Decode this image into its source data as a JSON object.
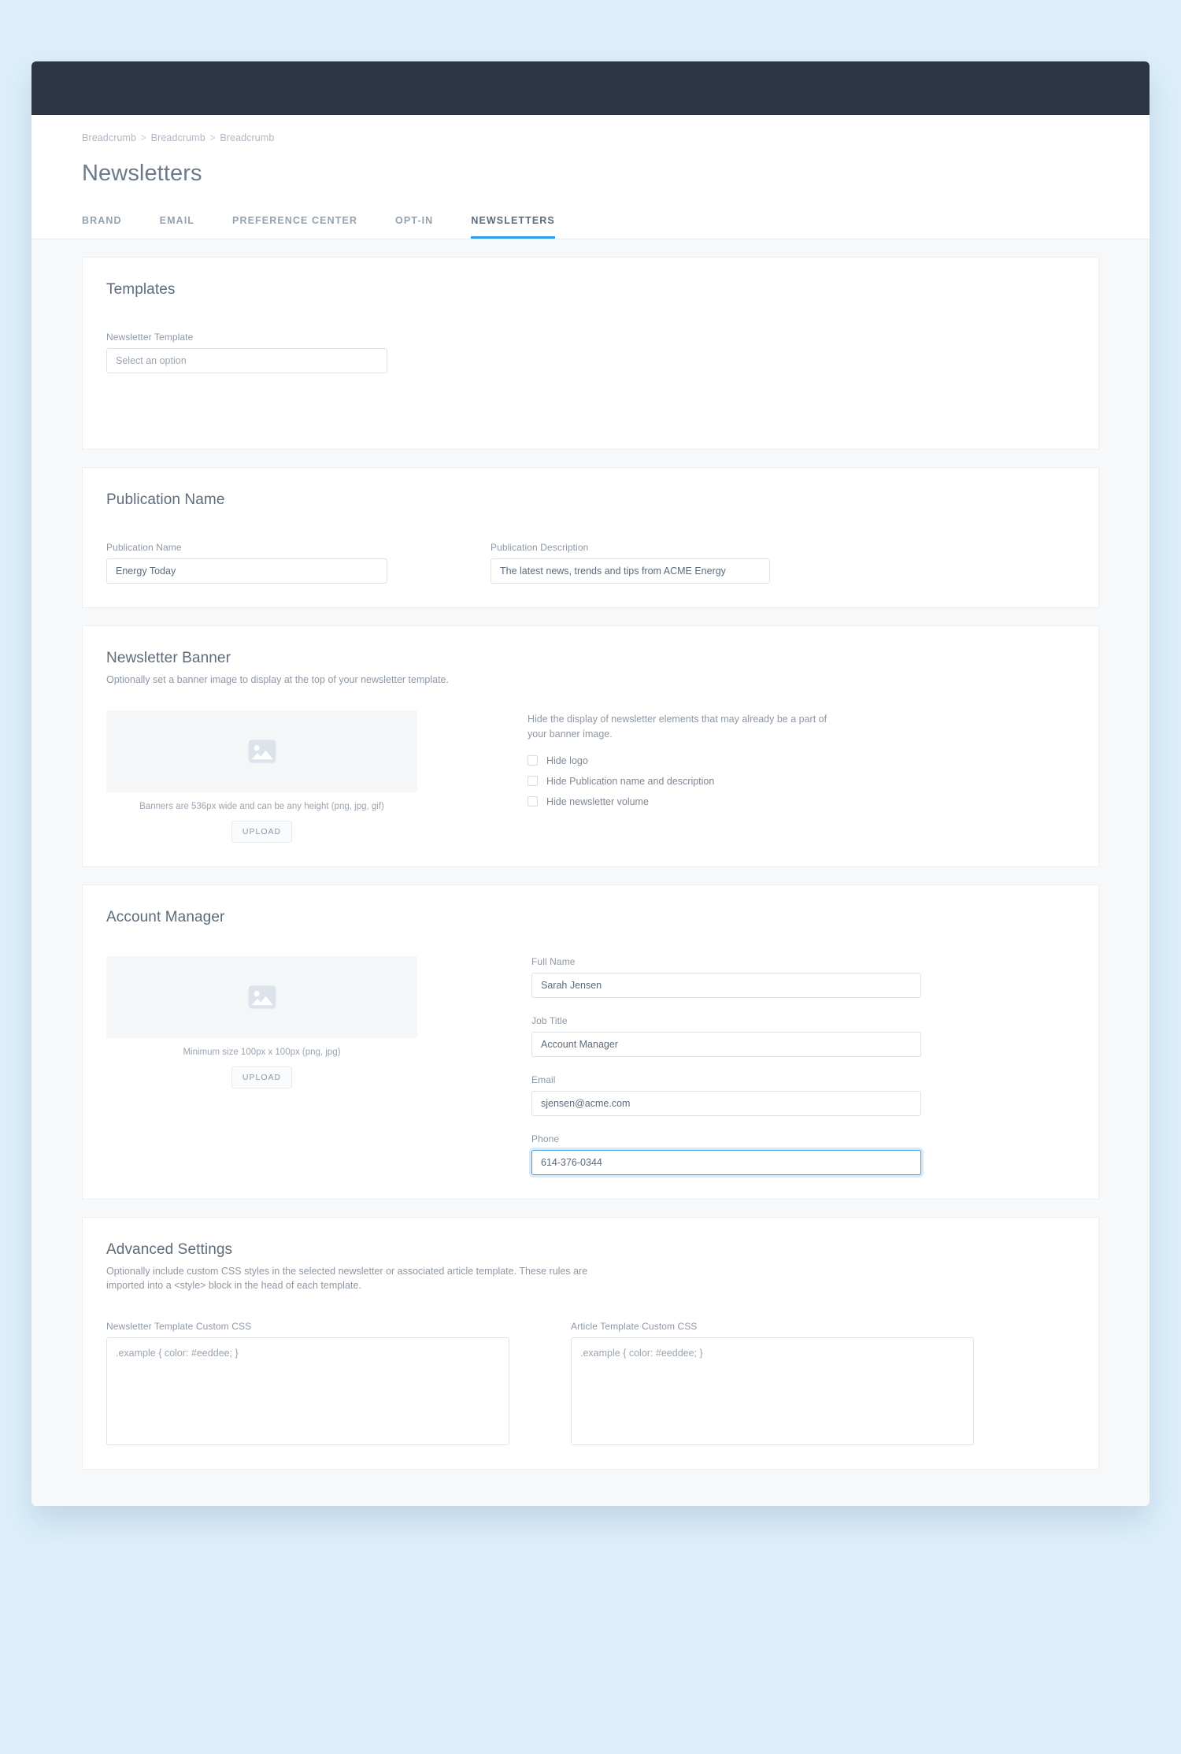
{
  "theme": {
    "page_background": "#ddeffc",
    "topbar": "#2b3544",
    "content_background": "#f7f8f9",
    "card_background": "#ffffff",
    "accent": "#2f9bec",
    "focus_border": "#4a9ee8",
    "label_text": "#8d98a5",
    "title_text": "#5d6b7a"
  },
  "breadcrumb": {
    "items": [
      "Breadcrumb",
      "Breadcrumb",
      "Breadcrumb"
    ],
    "separator": ">"
  },
  "header": {
    "title": "Newsletters"
  },
  "tabs": [
    {
      "label": "BRAND",
      "active": false
    },
    {
      "label": "EMAIL",
      "active": false
    },
    {
      "label": "PREFERENCE CENTER",
      "active": false
    },
    {
      "label": "OPT-IN",
      "active": false
    },
    {
      "label": "NEWSLETTERS",
      "active": true
    }
  ],
  "templates_card": {
    "title": "Templates",
    "newsletter_template": {
      "label": "Newsletter Template",
      "value": "",
      "placeholder": "Select an option",
      "options": [
        "Select an option"
      ]
    }
  },
  "publication_card": {
    "title": "Publication Name",
    "name_field": {
      "label": "Publication Name",
      "value": "Energy Today",
      "placeholder": "Publication Name"
    },
    "description_field": {
      "label": "Publication Description",
      "value": "The latest news, trends and tips from ACME Energy",
      "placeholder": "Publication Description"
    }
  },
  "banner_card": {
    "title": "Newsletter Banner",
    "subtitle": "Optionally set a banner image to display at the top of your newsletter template.",
    "image_icon": "image-placeholder-icon",
    "hint": "Banners are 536px wide and can be any height (png, jpg, gif)",
    "upload_label": "UPLOAD",
    "options_text": "Hide the display of newsletter elements that may already be a part of your banner image.",
    "checkboxes": [
      {
        "label": "Hide logo",
        "checked": false
      },
      {
        "label": "Hide Publication name and description",
        "checked": false
      },
      {
        "label": "Hide newsletter volume",
        "checked": false
      }
    ]
  },
  "manager_card": {
    "title": "Account Manager",
    "image_icon": "image-placeholder-icon",
    "hint": "Minimum size 100px x 100px (png, jpg)",
    "upload_label": "UPLOAD",
    "fields": [
      {
        "label": "Full Name",
        "value": "Sarah Jensen",
        "placeholder": "Full Name",
        "focused": false
      },
      {
        "label": "Job Title",
        "value": "Account Manager",
        "placeholder": "Job Title",
        "focused": false
      },
      {
        "label": "Email",
        "value": "sjensen@acme.com",
        "placeholder": "Email",
        "focused": false
      },
      {
        "label": "Phone",
        "value": "614-376-0344",
        "placeholder": "Phone",
        "focused": true
      }
    ]
  },
  "advanced_card": {
    "title": "Advanced Settings",
    "subtitle": "Optionally include custom CSS styles in the selected newsletter or associated article template. These rules are imported into a <style> block in the head of each template.",
    "newsletter_css": {
      "label": "Newsletter Template Custom CSS",
      "value": "",
      "placeholder": ".example { color: #eeddee; }"
    },
    "article_css": {
      "label": "Article Template Custom CSS",
      "value": "",
      "placeholder": ".example { color: #eeddee; }"
    }
  }
}
